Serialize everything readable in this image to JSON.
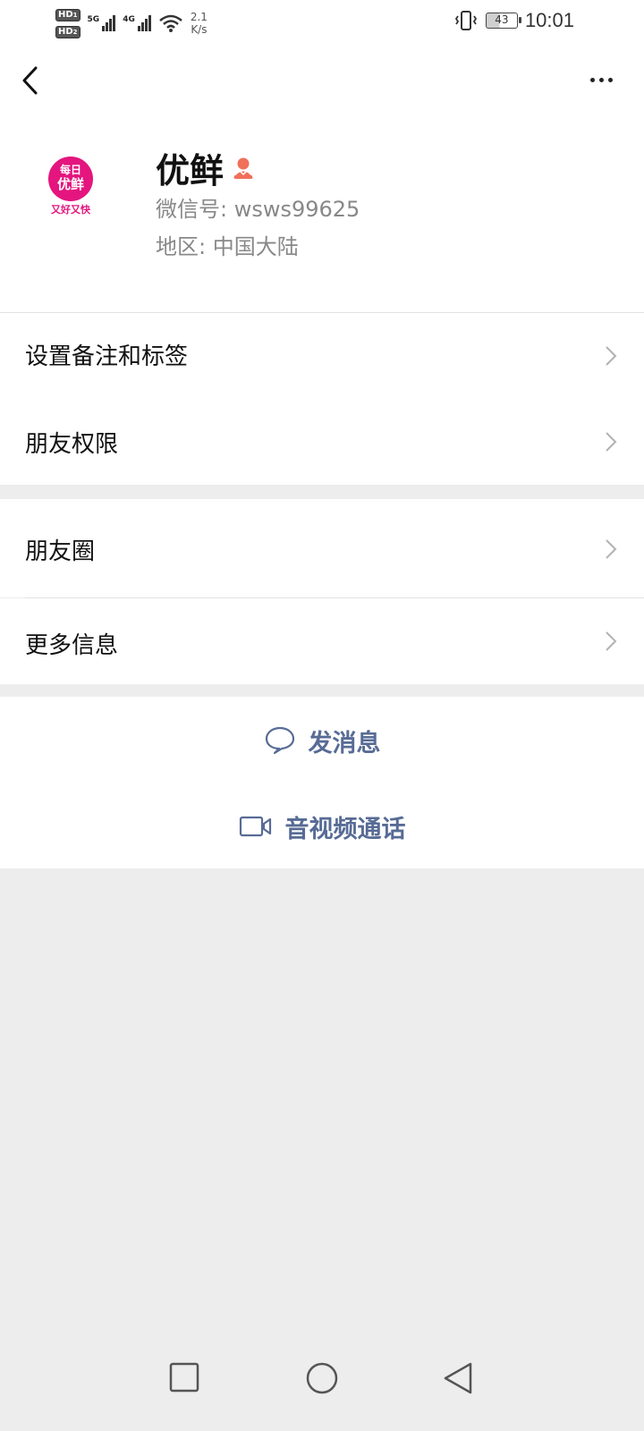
{
  "status_bar": {
    "hd1": "HD",
    "hd1_sub": "1",
    "hd2": "HD",
    "hd2_sub": "2",
    "network1": "5G",
    "network2": "4G",
    "speed_value": "2.1",
    "speed_unit": "K/s",
    "battery": "43",
    "time": "10:01",
    "icons": [
      "signal-icon",
      "wifi-icon",
      "vibrate-icon",
      "battery-icon"
    ]
  },
  "top_bar": {
    "back_icon": "chevron-left-icon",
    "more_icon": "more-dots-icon"
  },
  "profile": {
    "avatar_icon": "youxian-logo",
    "avatar_text_top": "每日",
    "avatar_text_main": "优鲜",
    "avatar_text_bottom": "又好又快",
    "name": "优鲜",
    "gender_icon": "female-icon",
    "wechat_id": "微信号: wsws99625",
    "region": "地区: 中国大陆"
  },
  "menu_group1": [
    {
      "label": "设置备注和标签"
    },
    {
      "label": "朋友权限"
    }
  ],
  "menu_group2": [
    {
      "label": "朋友圈"
    },
    {
      "label": "更多信息"
    }
  ],
  "actions": {
    "message_label": "发消息",
    "call_label": "音视频通话"
  },
  "colors": {
    "link_blue": "#576b95",
    "background_gray": "#ededed",
    "brand_pink": "#e4157e",
    "gender_orange": "#f0705a"
  }
}
